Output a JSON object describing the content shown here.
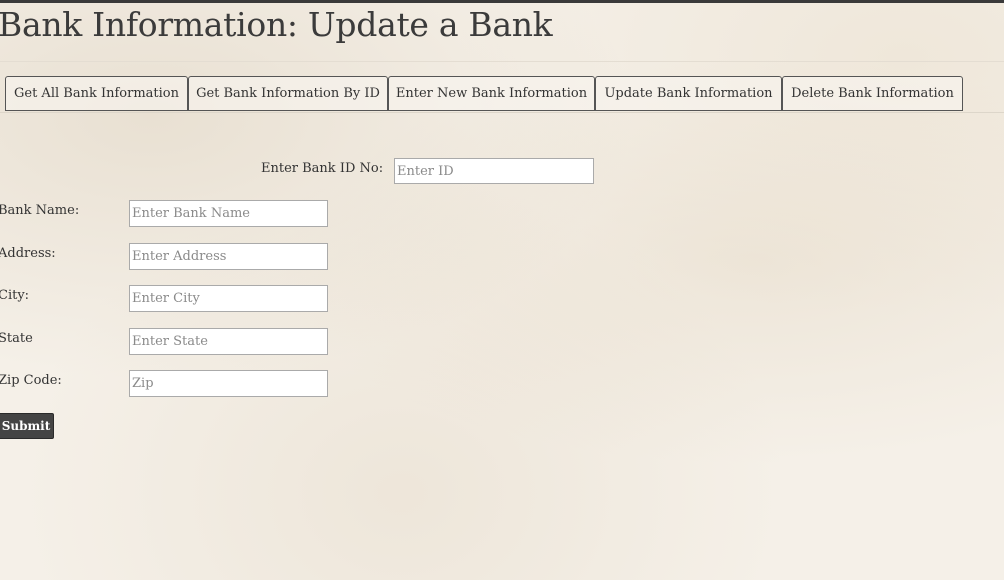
{
  "page": {
    "title": "Bank Information: Update a Bank"
  },
  "nav": {
    "tabs": [
      {
        "label": "Get All Bank Information"
      },
      {
        "label": "Get Bank Information By ID"
      },
      {
        "label": "Enter New Bank Information"
      },
      {
        "label": "Update Bank Information"
      },
      {
        "label": "Delete Bank Information"
      }
    ]
  },
  "form": {
    "bank_id": {
      "label": "Enter Bank ID No:",
      "placeholder": "Enter ID",
      "value": ""
    },
    "bank_name": {
      "label": "Bank Name:",
      "placeholder": "Enter Bank Name",
      "value": ""
    },
    "address": {
      "label": "Address:",
      "placeholder": "Enter Address",
      "value": ""
    },
    "city": {
      "label": "City:",
      "placeholder": "Enter City",
      "value": ""
    },
    "state": {
      "label": "State",
      "placeholder": "Enter State",
      "value": ""
    },
    "zip": {
      "label": "Zip Code:",
      "placeholder": "Zip",
      "value": ""
    },
    "submit_label": "Submit"
  },
  "colors": {
    "top_bar": "#3a3a3a",
    "button_bg": "#444444",
    "background": "#f5f0e8"
  }
}
